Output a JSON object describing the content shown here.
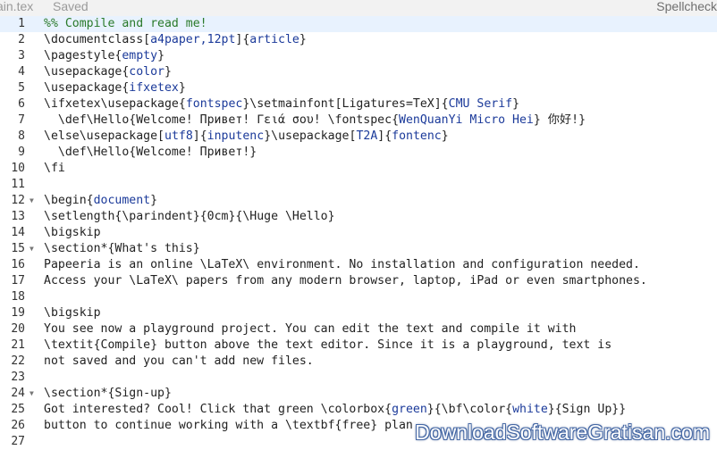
{
  "topbar": {
    "filename": "ain.tex",
    "status": "Saved",
    "spellcheck": "Spellcheck"
  },
  "editor": {
    "active_line": 1,
    "lines": [
      {
        "num": "1",
        "fold": "",
        "segments": [
          {
            "t": "%% Compile and read me!",
            "c": "comment"
          }
        ]
      },
      {
        "num": "2",
        "fold": "",
        "segments": [
          {
            "t": "\\documentclass",
            "c": "tag"
          },
          {
            "t": "[",
            "c": "bracket"
          },
          {
            "t": "a4paper,12pt",
            "c": "keyword"
          },
          {
            "t": "]{",
            "c": "bracket"
          },
          {
            "t": "article",
            "c": "keyword"
          },
          {
            "t": "}",
            "c": "bracket"
          }
        ]
      },
      {
        "num": "3",
        "fold": "",
        "segments": [
          {
            "t": "\\pagestyle",
            "c": "tag"
          },
          {
            "t": "{",
            "c": "bracket"
          },
          {
            "t": "empty",
            "c": "keyword"
          },
          {
            "t": "}",
            "c": "bracket"
          }
        ]
      },
      {
        "num": "4",
        "fold": "",
        "segments": [
          {
            "t": "\\usepackage",
            "c": "tag"
          },
          {
            "t": "{",
            "c": "bracket"
          },
          {
            "t": "color",
            "c": "keyword"
          },
          {
            "t": "}",
            "c": "bracket"
          }
        ]
      },
      {
        "num": "5",
        "fold": "",
        "segments": [
          {
            "t": "\\usepackage",
            "c": "tag"
          },
          {
            "t": "{",
            "c": "bracket"
          },
          {
            "t": "ifxetex",
            "c": "keyword"
          },
          {
            "t": "}",
            "c": "bracket"
          }
        ]
      },
      {
        "num": "6",
        "fold": "",
        "segments": [
          {
            "t": "\\ifxetex\\usepackage",
            "c": "tag"
          },
          {
            "t": "{",
            "c": "bracket"
          },
          {
            "t": "fontspec",
            "c": "keyword"
          },
          {
            "t": "}",
            "c": "bracket"
          },
          {
            "t": "\\setmainfont",
            "c": "tag"
          },
          {
            "t": "[Ligatures=TeX]{",
            "c": "bracket"
          },
          {
            "t": "CMU Serif",
            "c": "keyword"
          },
          {
            "t": "}",
            "c": "bracket"
          }
        ]
      },
      {
        "num": "7",
        "fold": "",
        "segments": [
          {
            "t": "  \\def\\Hello",
            "c": "tag"
          },
          {
            "t": "{Welcome! Привет! Γειά σου! ",
            "c": "plain"
          },
          {
            "t": "\\fontspec",
            "c": "tag"
          },
          {
            "t": "{",
            "c": "bracket"
          },
          {
            "t": "WenQuanYi Micro Hei",
            "c": "keyword"
          },
          {
            "t": "} 你好!}",
            "c": "plain"
          }
        ]
      },
      {
        "num": "8",
        "fold": "",
        "segments": [
          {
            "t": "\\else\\usepackage",
            "c": "tag"
          },
          {
            "t": "[",
            "c": "bracket"
          },
          {
            "t": "utf8",
            "c": "keyword"
          },
          {
            "t": "]{",
            "c": "bracket"
          },
          {
            "t": "inputenc",
            "c": "keyword"
          },
          {
            "t": "}",
            "c": "bracket"
          },
          {
            "t": "\\usepackage",
            "c": "tag"
          },
          {
            "t": "[",
            "c": "bracket"
          },
          {
            "t": "T2A",
            "c": "keyword"
          },
          {
            "t": "]{",
            "c": "bracket"
          },
          {
            "t": "fontenc",
            "c": "keyword"
          },
          {
            "t": "}",
            "c": "bracket"
          }
        ]
      },
      {
        "num": "9",
        "fold": "",
        "segments": [
          {
            "t": "  \\def\\Hello",
            "c": "tag"
          },
          {
            "t": "{Welcome! Привет!}",
            "c": "plain"
          }
        ]
      },
      {
        "num": "10",
        "fold": "",
        "segments": [
          {
            "t": "\\fi",
            "c": "tag"
          }
        ]
      },
      {
        "num": "11",
        "fold": "",
        "segments": []
      },
      {
        "num": "12",
        "fold": "▼",
        "segments": [
          {
            "t": "\\begin",
            "c": "tag"
          },
          {
            "t": "{",
            "c": "bracket"
          },
          {
            "t": "document",
            "c": "keyword"
          },
          {
            "t": "}",
            "c": "bracket"
          }
        ]
      },
      {
        "num": "13",
        "fold": "",
        "segments": [
          {
            "t": "\\setlength",
            "c": "tag"
          },
          {
            "t": "{",
            "c": "bracket"
          },
          {
            "t": "\\parindent",
            "c": "tag"
          },
          {
            "t": "}{0cm}{",
            "c": "bracket"
          },
          {
            "t": "\\Huge \\Hello",
            "c": "tag"
          },
          {
            "t": "}",
            "c": "bracket"
          }
        ]
      },
      {
        "num": "14",
        "fold": "",
        "segments": [
          {
            "t": "\\bigskip",
            "c": "tag"
          }
        ]
      },
      {
        "num": "15",
        "fold": "▼",
        "segments": [
          {
            "t": "\\section",
            "c": "tag"
          },
          {
            "t": "*{What's this}",
            "c": "plain"
          }
        ]
      },
      {
        "num": "16",
        "fold": "",
        "segments": [
          {
            "t": "Papeeria is an online ",
            "c": "plain"
          },
          {
            "t": "\\LaTeX\\",
            "c": "tag"
          },
          {
            "t": " environment. No installation and configuration needed.",
            "c": "plain"
          }
        ]
      },
      {
        "num": "17",
        "fold": "",
        "segments": [
          {
            "t": "Access your ",
            "c": "plain"
          },
          {
            "t": "\\LaTeX\\",
            "c": "tag"
          },
          {
            "t": " papers from any modern browser, laptop, iPad or even smartphones.",
            "c": "plain"
          }
        ]
      },
      {
        "num": "18",
        "fold": "",
        "segments": []
      },
      {
        "num": "19",
        "fold": "",
        "segments": [
          {
            "t": "\\bigskip",
            "c": "tag"
          }
        ]
      },
      {
        "num": "20",
        "fold": "",
        "segments": [
          {
            "t": "You see now a playground project. You can edit the text and compile it with",
            "c": "plain"
          }
        ]
      },
      {
        "num": "21",
        "fold": "",
        "segments": [
          {
            "t": "\\textit",
            "c": "tag"
          },
          {
            "t": "{Compile} button above the text editor. Since it is a playground, text is",
            "c": "plain"
          }
        ]
      },
      {
        "num": "22",
        "fold": "",
        "segments": [
          {
            "t": "not saved and you can't add new files.",
            "c": "plain"
          }
        ]
      },
      {
        "num": "23",
        "fold": "",
        "segments": []
      },
      {
        "num": "24",
        "fold": "▼",
        "segments": [
          {
            "t": "\\section",
            "c": "tag"
          },
          {
            "t": "*{Sign-up}",
            "c": "plain"
          }
        ]
      },
      {
        "num": "25",
        "fold": "",
        "segments": [
          {
            "t": "Got interested? Cool! Click that green ",
            "c": "plain"
          },
          {
            "t": "\\colorbox",
            "c": "tag"
          },
          {
            "t": "{",
            "c": "bracket"
          },
          {
            "t": "green",
            "c": "keyword"
          },
          {
            "t": "}{",
            "c": "bracket"
          },
          {
            "t": "\\bf\\color",
            "c": "tag"
          },
          {
            "t": "{",
            "c": "bracket"
          },
          {
            "t": "white",
            "c": "keyword"
          },
          {
            "t": "}{Sign Up}}",
            "c": "plain"
          }
        ]
      },
      {
        "num": "26",
        "fold": "",
        "segments": [
          {
            "t": "button to continue working with a ",
            "c": "plain"
          },
          {
            "t": "\\textbf",
            "c": "tag"
          },
          {
            "t": "{free} plan",
            "c": "plain"
          }
        ]
      },
      {
        "num": "27",
        "fold": "",
        "segments": []
      }
    ]
  },
  "watermark": {
    "text": "DownloadSoftwareGratisan.com"
  }
}
